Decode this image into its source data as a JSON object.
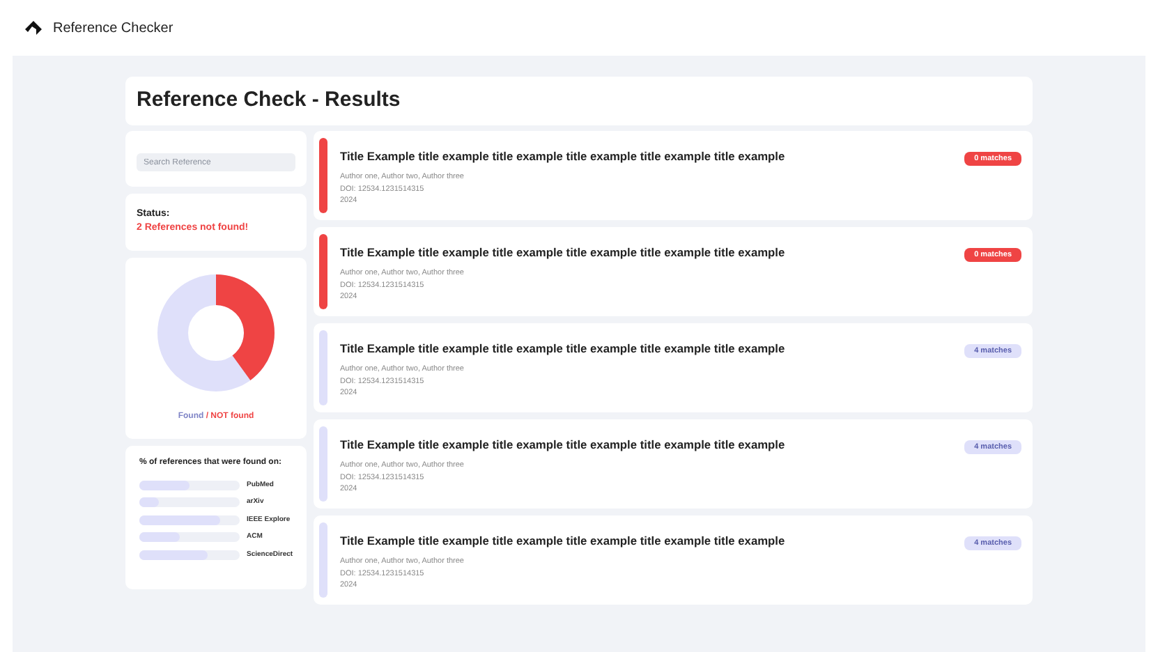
{
  "app": {
    "name": "Reference Checker"
  },
  "page_title": "Reference Check - Results",
  "search": {
    "placeholder": "Search Reference"
  },
  "status": {
    "label": "Status:",
    "message": "2 References not found!"
  },
  "legend": {
    "found": "Found",
    "separator": " / ",
    "not_found": "NOT found"
  },
  "sources": {
    "title": "% of references that were found on:",
    "items": [
      {
        "name": "PubMed",
        "level": 0.5
      },
      {
        "name": "arXiv",
        "level": 0.2
      },
      {
        "name": "IEEE Explore",
        "level": 0.8
      },
      {
        "name": "ACM",
        "level": 0.4
      },
      {
        "name": "ScienceDirect",
        "level": 0.68
      }
    ]
  },
  "references": [
    {
      "title": "Title Example title example title example title example title example title example",
      "authors": "Author one, Author two, Author three",
      "doi": "DOI: 12534.1231514315",
      "year": "2024",
      "matches": "0 matches",
      "found": false
    },
    {
      "title": "Title Example title example title example title example title example title example",
      "authors": "Author one, Author two, Author three",
      "doi": "DOI: 12534.1231514315",
      "year": "2024",
      "matches": "0 matches",
      "found": false
    },
    {
      "title": "Title Example title example title example title example title example title example",
      "authors": "Author one, Author two, Author three",
      "doi": "DOI: 12534.1231514315",
      "year": "2024",
      "matches": "4 matches",
      "found": true
    },
    {
      "title": "Title Example title example title example title example title example title example",
      "authors": "Author one, Author two, Author three",
      "doi": "DOI: 12534.1231514315",
      "year": "2024",
      "matches": "4 matches",
      "found": true
    },
    {
      "title": "Title Example title example title example title example title example title example",
      "authors": "Author one, Author two, Author three",
      "doi": "DOI: 12534.1231514315",
      "year": "2024",
      "matches": "4 matches",
      "found": true
    }
  ]
}
